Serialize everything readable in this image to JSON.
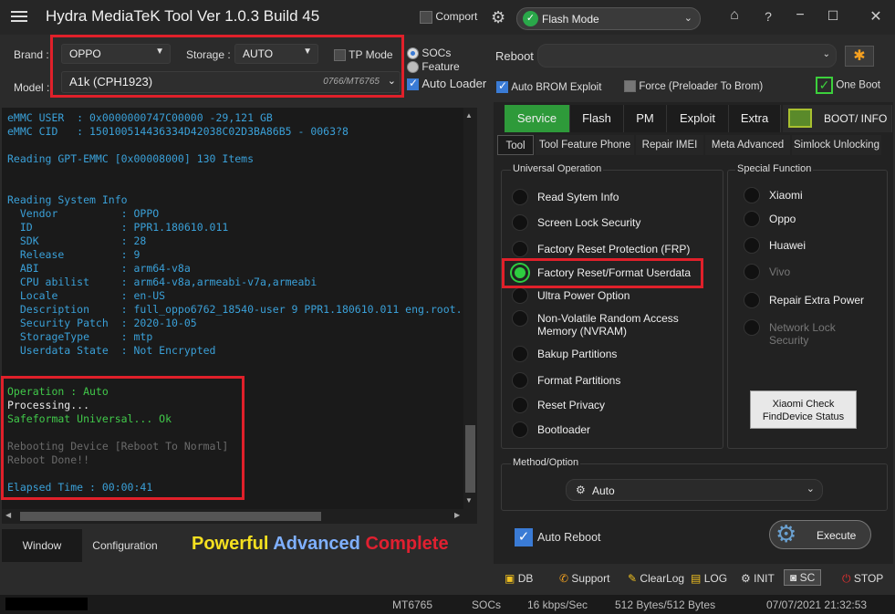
{
  "app": {
    "title": "Hydra MediaTeK Tool  Ver 1.0.3 Build 45",
    "comport_label": "Comport",
    "flash_mode": "Flash Mode"
  },
  "device": {
    "brand_label": "Brand :",
    "brand_value": "OPPO",
    "storage_label": "Storage :",
    "storage_value": "AUTO",
    "tp_mode_label": "TP Mode",
    "model_label": "Model :",
    "model_value": "A1k (CPH1923)",
    "model_chip": "0766/MT6765",
    "socs_label": "SOCs",
    "feature_label": "Feature",
    "auto_loader_label": "Auto Loader"
  },
  "reboot": {
    "label": "Reboot",
    "auto_brom": "Auto BROM Exploit",
    "force_preloader": "Force (Preloader To Brom)",
    "one_boot": "One Boot"
  },
  "console": {
    "lines": [
      {
        "t": "eMMC USER  : 0x0000000747C00000 -29,121 GB",
        "c": "c-blue"
      },
      {
        "t": "eMMC CID   : 150100514436334D42038C02D3BA86B5 - 0063?8",
        "c": "c-blue"
      },
      {
        "t": "",
        "c": ""
      },
      {
        "t": "Reading GPT-EMMC [0x00008000] 130 Items",
        "c": "c-blue"
      },
      {
        "t": "",
        "c": ""
      },
      {
        "t": "",
        "c": ""
      },
      {
        "t": "Reading System Info",
        "c": "c-blue"
      },
      {
        "t": "  Vendor          : OPPO",
        "c": "c-blue"
      },
      {
        "t": "  ID              : PPR1.180610.011",
        "c": "c-blue"
      },
      {
        "t": "  SDK             : 28",
        "c": "c-blue"
      },
      {
        "t": "  Release         : 9",
        "c": "c-blue"
      },
      {
        "t": "  ABI             : arm64-v8a",
        "c": "c-blue"
      },
      {
        "t": "  CPU abilist     : arm64-v8a,armeabi-v7a,armeabi",
        "c": "c-blue"
      },
      {
        "t": "  Locale          : en-US",
        "c": "c-blue"
      },
      {
        "t": "  Description     : full_oppo6762_18540-user 9 PPR1.180610.011 eng.root.",
        "c": "c-blue"
      },
      {
        "t": "  Security Patch  : 2020-10-05",
        "c": "c-blue"
      },
      {
        "t": "  StorageType     : mtp",
        "c": "c-blue"
      },
      {
        "t": "  Userdata State  : Not Encrypted",
        "c": "c-blue"
      },
      {
        "t": "",
        "c": ""
      },
      {
        "t": "",
        "c": ""
      },
      {
        "t": "Operation : Auto",
        "c": "c-green"
      },
      {
        "t": "Processing...",
        "c": "c-white"
      },
      {
        "t": "Safeformat Universal... Ok",
        "c": "c-green"
      },
      {
        "t": "",
        "c": ""
      },
      {
        "t": "Rebooting Device [Reboot To Normal]",
        "c": "c-dim"
      },
      {
        "t": "Reboot Done!!",
        "c": "c-dim"
      },
      {
        "t": "",
        "c": ""
      },
      {
        "t": "Elapsed Time : 00:00:41",
        "c": "c-blue"
      }
    ]
  },
  "bottom_tabs": {
    "window": "Window",
    "configuration": "Configuration"
  },
  "slogan": {
    "w1": "Powerful",
    "w2": "Advanced",
    "w3": "Complete",
    "c1": "#f5e020",
    "c2": "#7fb0ff",
    "c3": "#e02030"
  },
  "main_tabs": {
    "service": "Service",
    "flash": "Flash",
    "pm": "PM",
    "exploit": "Exploit",
    "extra": "Extra",
    "boot_info": "BOOT/ INFO"
  },
  "sub_tabs": {
    "tool": "Tool",
    "feature_phone": "Tool Feature Phone",
    "repair_imei": "Repair IMEI",
    "meta": "Meta Advanced",
    "simlock": "Simlock Unlocking"
  },
  "universal": {
    "title": "Universal Operation",
    "items": [
      "Read Sytem Info",
      "Screen Lock Security",
      "Factory Reset Protection (FRP)",
      "Factory Reset/Format Userdata",
      "Ultra Power Option",
      "Non-Volatile Random Access\nMemory (NVRAM)",
      "Bakup Partitions",
      "Format Partitions",
      "Reset Privacy",
      "Bootloader"
    ]
  },
  "special": {
    "title": "Special Function",
    "items": [
      "Xiaomi",
      "Oppo",
      "Huawei",
      "Vivo",
      "Repair Extra Power",
      "Network Lock\nSecurity"
    ],
    "xiaomi_check": "Xiaomi Check\nFindDevice Status"
  },
  "method": {
    "title": "Method/Option",
    "value": "Auto"
  },
  "execute": {
    "auto_reboot": "Auto Reboot",
    "button": "Execute"
  },
  "toolbar": {
    "db": "DB",
    "support": "Support",
    "clearlog": "ClearLog",
    "log": "LOG",
    "init": "INIT",
    "sc": "SC",
    "stop": "STOP"
  },
  "status": {
    "chip": "MT6765",
    "mode": "SOCs",
    "speed": "16 kbps/Sec",
    "bytes": "512 Bytes/512 Bytes",
    "datetime": "07/07/2021 21:32:53"
  }
}
